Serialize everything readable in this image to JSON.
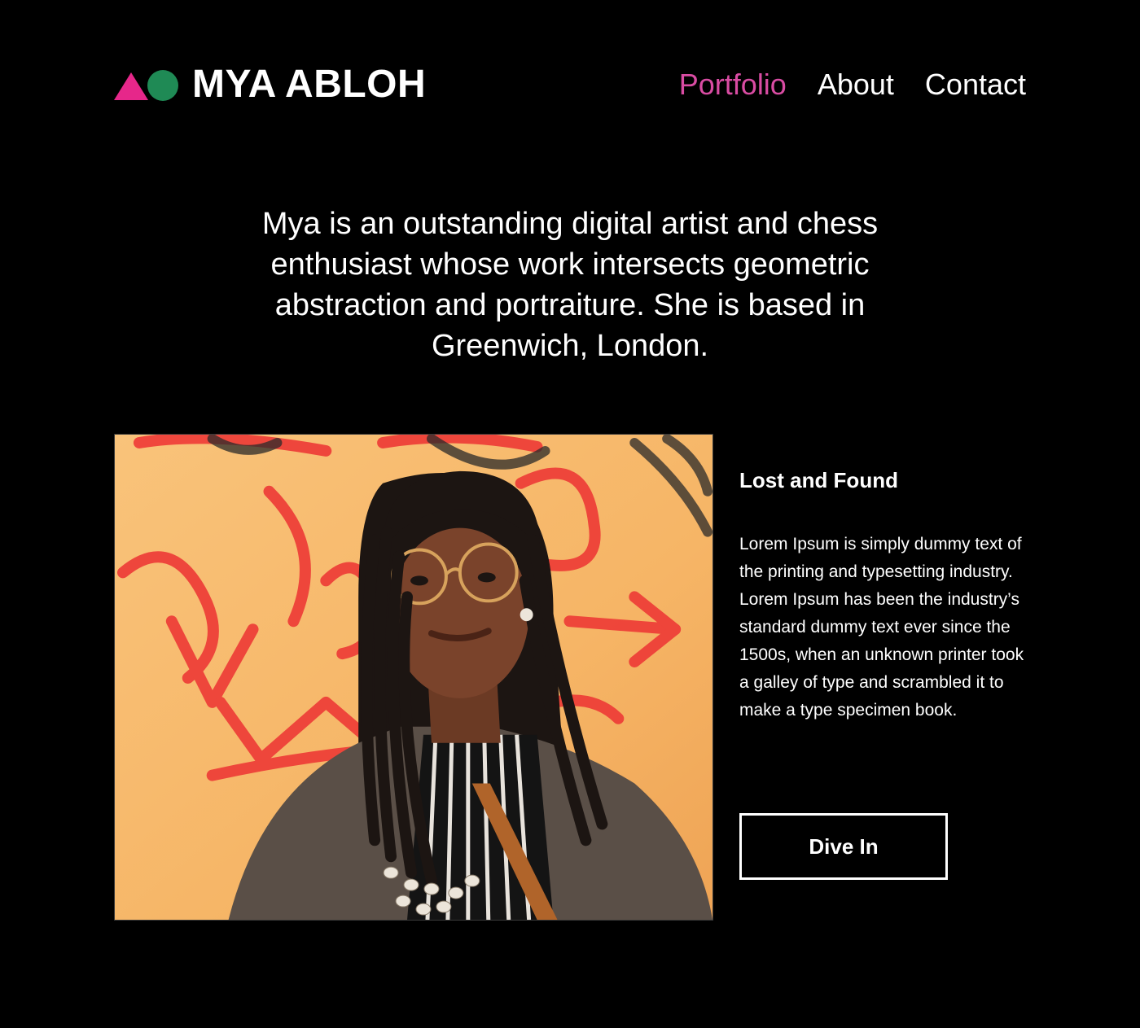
{
  "header": {
    "brand_name": "MYA ABLOH",
    "logo_icons": [
      "triangle-icon",
      "circle-icon"
    ],
    "nav": [
      {
        "label": "Portfolio",
        "active": true
      },
      {
        "label": "About",
        "active": false
      },
      {
        "label": "Contact",
        "active": false
      }
    ]
  },
  "intro": {
    "text": "Mya is an outstanding digital artist and chess enthusiast whose work intersects geometric abstraction and portraiture. She is based in Greenwich, London."
  },
  "feature": {
    "title": "Lost and Found",
    "description": "Lorem Ipsum is simply dummy text of the printing and typesetting industry. Lorem Ipsum has been the industry’s standard dummy text ever since the 1500s, when an unknown printer took a galley of type and scrambled it to make a type specimen book.",
    "button_label": "Dive In"
  },
  "colors": {
    "background": "#000000",
    "text": "#ffffff",
    "accent_pink": "#e6278a",
    "accent_green": "#1f8a55",
    "nav_active": "#d94ca3"
  }
}
